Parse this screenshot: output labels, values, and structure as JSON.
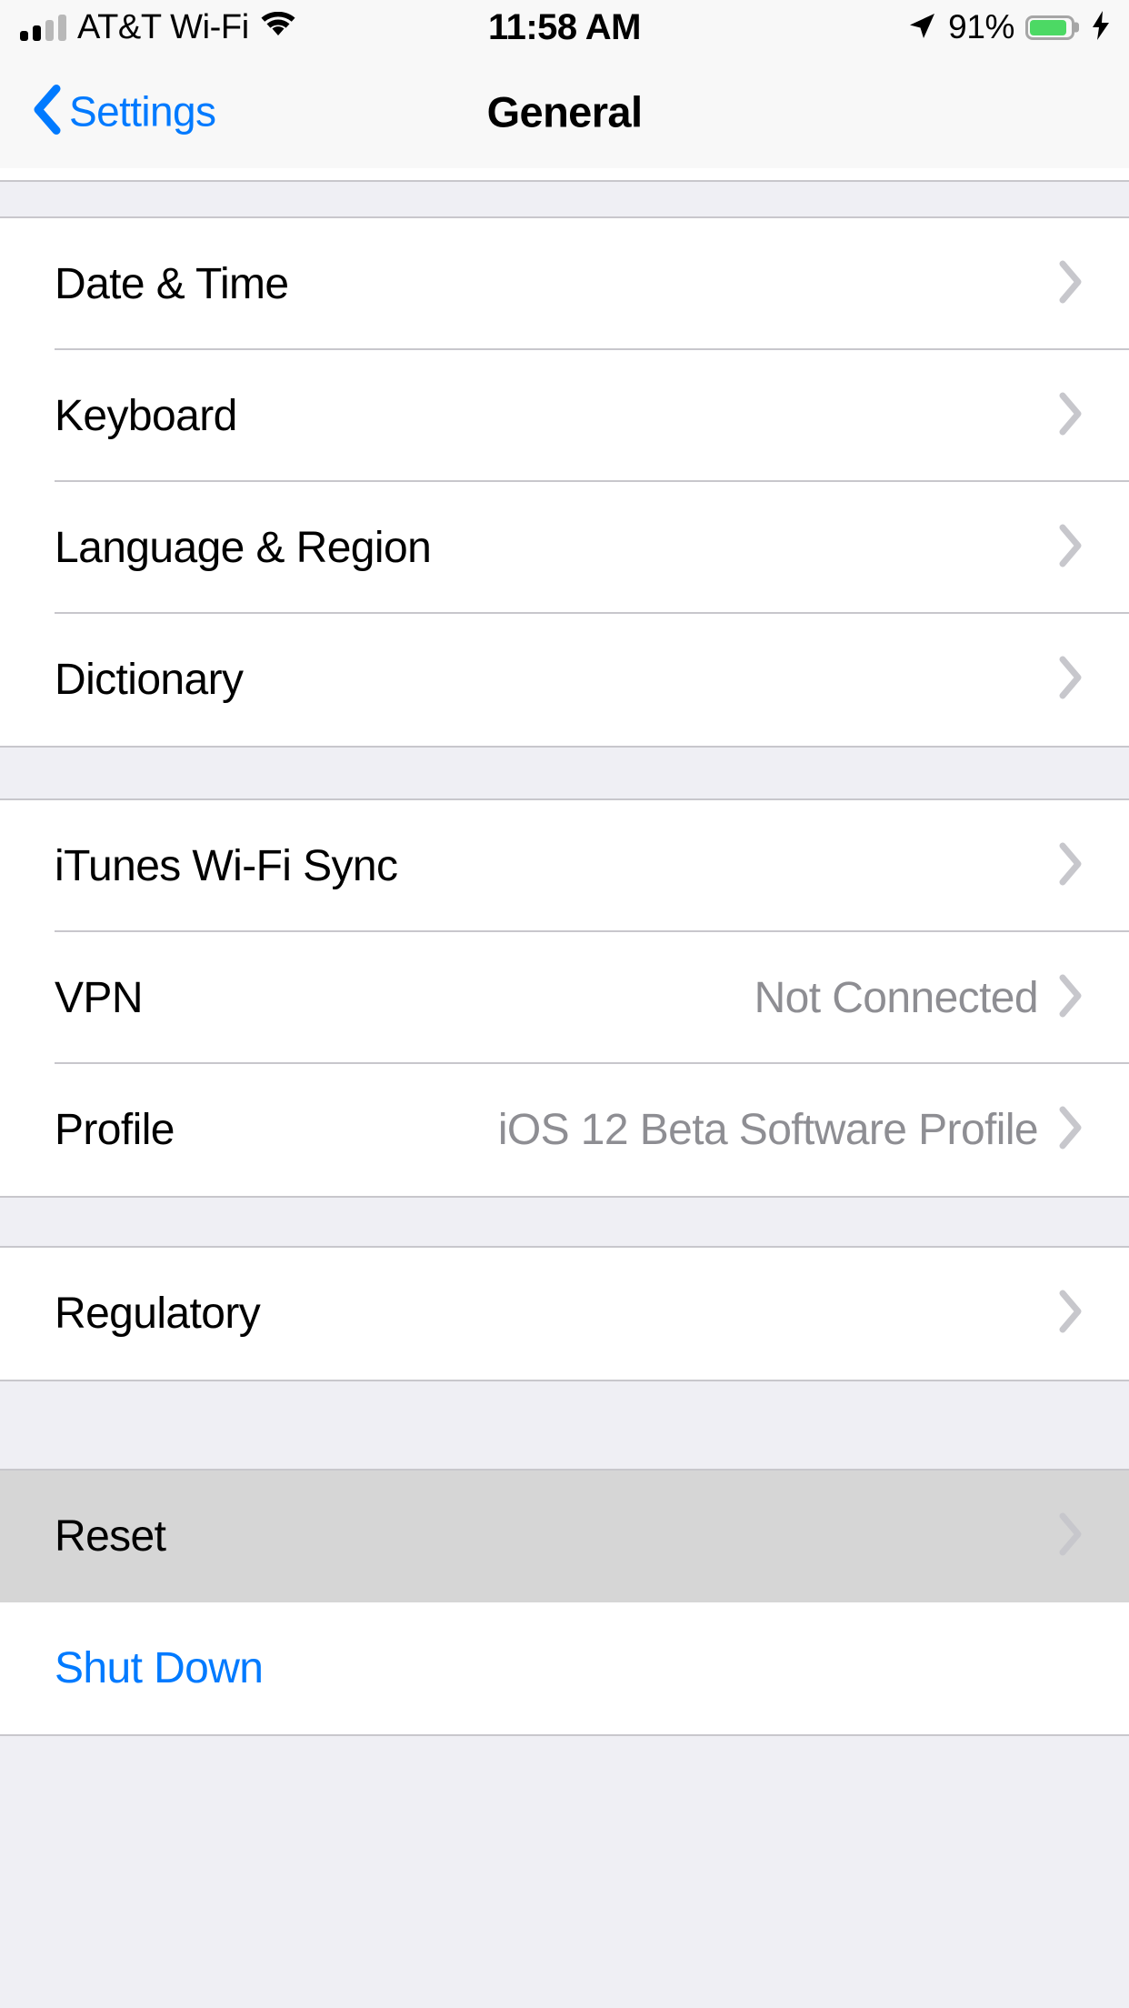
{
  "status_bar": {
    "signal_icon": "signal-bars-icon",
    "signal_bars_filled": 2,
    "signal_bars_total": 4,
    "carrier": "AT&T Wi-Fi",
    "wifi_icon": "wifi-icon",
    "time": "11:58 AM",
    "location_icon": "location-arrow-icon",
    "battery_percent": "91%",
    "battery_level": 91,
    "battery_icon": "battery-icon",
    "battery_color": "#4cd964",
    "charging_icon": "lightning-bolt-icon"
  },
  "nav_bar": {
    "back_icon": "chevron-left-icon",
    "back_label": "Settings",
    "title": "General"
  },
  "accent_color": "#007aff",
  "chevron_icon": "chevron-right-icon",
  "sections": [
    {
      "id": "section-datetime",
      "rows": [
        {
          "label": "Date & Time",
          "value": "",
          "style": "default",
          "chevron": true,
          "highlighted": false
        },
        {
          "label": "Keyboard",
          "value": "",
          "style": "default",
          "chevron": true,
          "highlighted": false
        },
        {
          "label": "Language & Region",
          "value": "",
          "style": "default",
          "chevron": true,
          "highlighted": false
        },
        {
          "label": "Dictionary",
          "value": "",
          "style": "default",
          "chevron": true,
          "highlighted": false
        }
      ]
    },
    {
      "id": "section-sync",
      "rows": [
        {
          "label": "iTunes Wi-Fi Sync",
          "value": "",
          "style": "default",
          "chevron": true,
          "highlighted": false
        },
        {
          "label": "VPN",
          "value": "Not Connected",
          "style": "default",
          "chevron": true,
          "highlighted": false
        },
        {
          "label": "Profile",
          "value": "iOS 12 Beta Software Profile",
          "style": "default",
          "chevron": true,
          "highlighted": false
        }
      ]
    },
    {
      "id": "section-regulatory",
      "rows": [
        {
          "label": "Regulatory",
          "value": "",
          "style": "default",
          "chevron": true,
          "highlighted": false
        }
      ]
    },
    {
      "id": "section-reset",
      "rows": [
        {
          "label": "Reset",
          "value": "",
          "style": "default",
          "chevron": true,
          "highlighted": true
        },
        {
          "label": "Shut Down",
          "value": "",
          "style": "blue",
          "chevron": false,
          "highlighted": false
        }
      ]
    }
  ]
}
